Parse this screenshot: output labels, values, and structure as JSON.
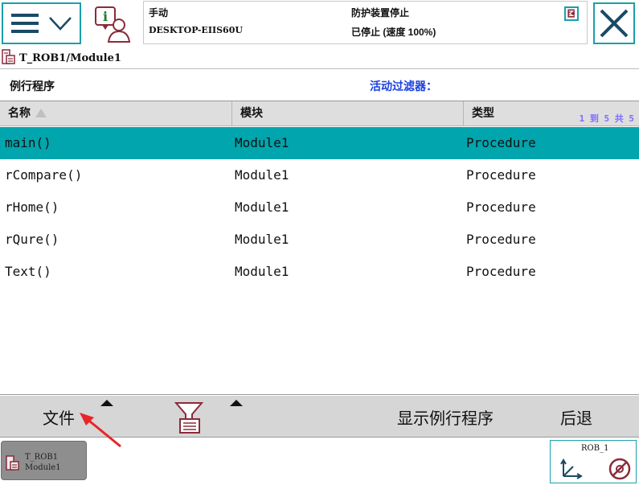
{
  "topbar": {
    "status": {
      "mode": "手动",
      "host": "DESKTOP-EIIS60U",
      "guard_state": "防护装置停止",
      "speed_state": "已停止 (速度 100%)"
    }
  },
  "path": {
    "text": "T_ROB1/Module1"
  },
  "section": {
    "title": "例行程序",
    "filter_label": "活动过滤器："
  },
  "table": {
    "columns": [
      "名称",
      "模块",
      "类型"
    ],
    "paging": "1 到 5 共 5",
    "rows": [
      {
        "name": "main()",
        "module": "Module1",
        "type": "Procedure",
        "selected": true
      },
      {
        "name": "rCompare()",
        "module": "Module1",
        "type": "Procedure",
        "selected": false
      },
      {
        "name": "rHome()",
        "module": "Module1",
        "type": "Procedure",
        "selected": false
      },
      {
        "name": "rQure()",
        "module": "Module1",
        "type": "Procedure",
        "selected": false
      },
      {
        "name": "Text()",
        "module": "Module1",
        "type": "Procedure",
        "selected": false
      }
    ]
  },
  "toolbar": {
    "file_label": "文件",
    "show_routine_label": "显示例行程序",
    "back_label": "后退"
  },
  "taskbar": {
    "task_line1": "T_ROB1",
    "task_line2": "Module1",
    "quickset_label": "ROB_1"
  },
  "colors": {
    "accent": "#1aa0ab",
    "selected_row": "#00a5ad",
    "filter_text": "#1a3fe0",
    "toolbar_bg": "#d6d6d6",
    "annotation": "#e8262a"
  },
  "icons": {
    "menu": "hamburger-chevron-icon",
    "info": "operator-info-icon",
    "status": "status-flag-icon",
    "close": "close-x-icon",
    "path": "program-module-icon",
    "sort": "sort-ascending-icon",
    "filter": "filter-funnel-icon",
    "axes": "jog-axes-icon",
    "increment": "increment-off-icon"
  }
}
